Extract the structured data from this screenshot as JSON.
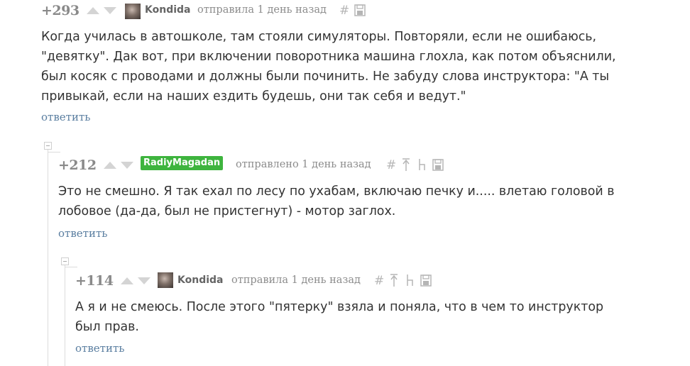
{
  "comments": [
    {
      "rating": "+293",
      "author": "Kondida",
      "meta": "отправила 1 день назад",
      "text": "Когда училась в автошколе, там стояли симуляторы. Повторяли, если не ошибаюсь,\n\"девятку\". Дак вот, при включении поворотника машина глохла, как потом объяснили,\nбыл косяк с проводами и должны были починить. Не забуду слова инструктора: \"А ты\nпривыкай, если на наших ездить будешь, они так себя и ведут.\"",
      "reply_label": "ответить",
      "icons": [
        "hash-icon",
        "save-icon"
      ]
    },
    {
      "rating": "+212",
      "author": "RadiyMagadan",
      "author_badge_color": "#3eb43e",
      "meta": "отправлено 1 день назад",
      "text": "Это не смешно. Я так ехал по лесу по ухабам, включаю печку и..... влетаю головой в\nлобовое (да-да, был не пристегнут) - мотор заглох.",
      "reply_label": "ответить",
      "icons": [
        "hash-icon",
        "parent-link-icon",
        "branch-icon",
        "save-icon"
      ]
    },
    {
      "rating": "+114",
      "author": "Kondida",
      "meta": "отправила 1 день назад",
      "text": "А я и не смеюсь. После этого \"пятерку\" взяла и поняла, что в чем то инструктор\nбыл прав.",
      "reply_label": "ответить",
      "icons": [
        "hash-icon",
        "parent-link-icon",
        "branch-icon",
        "save-icon"
      ]
    }
  ],
  "colors": {
    "rating": "#8a8a8a",
    "reply_link": "#5a7ea0",
    "text": "#333333",
    "icons": "#b5b5b5"
  }
}
